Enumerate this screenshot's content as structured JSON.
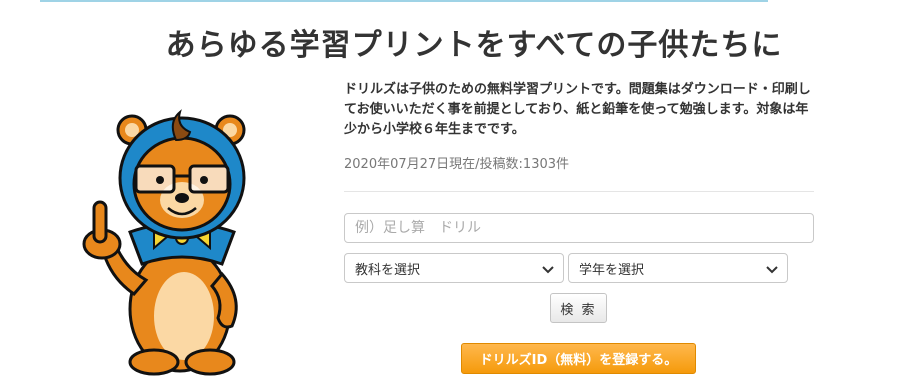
{
  "header": {
    "title": "あらゆる学習プリントをすべての子供たちに"
  },
  "intro": {
    "description": "ドリルズは子供のための無料学習プリントです。問題集はダウンロード・印刷してお使いいただく事を前提としており、紙と鉛筆を使って勉強します。対象は年少から小学校６年生までです。",
    "stats": "2020年07月27日現在/投稿数:1303件"
  },
  "search": {
    "placeholder": "例）足し算　ドリル",
    "subject_select": "教科を選択",
    "grade_select": "学年を選択",
    "search_button": "検 索"
  },
  "register": {
    "button_label": "ドリルズID（無料）を登録する。"
  },
  "mascot": {
    "icon": "bear-mascot-icon"
  },
  "colors": {
    "accent_orange": "#f59a0b",
    "top_rule": "#9fd3e6"
  }
}
